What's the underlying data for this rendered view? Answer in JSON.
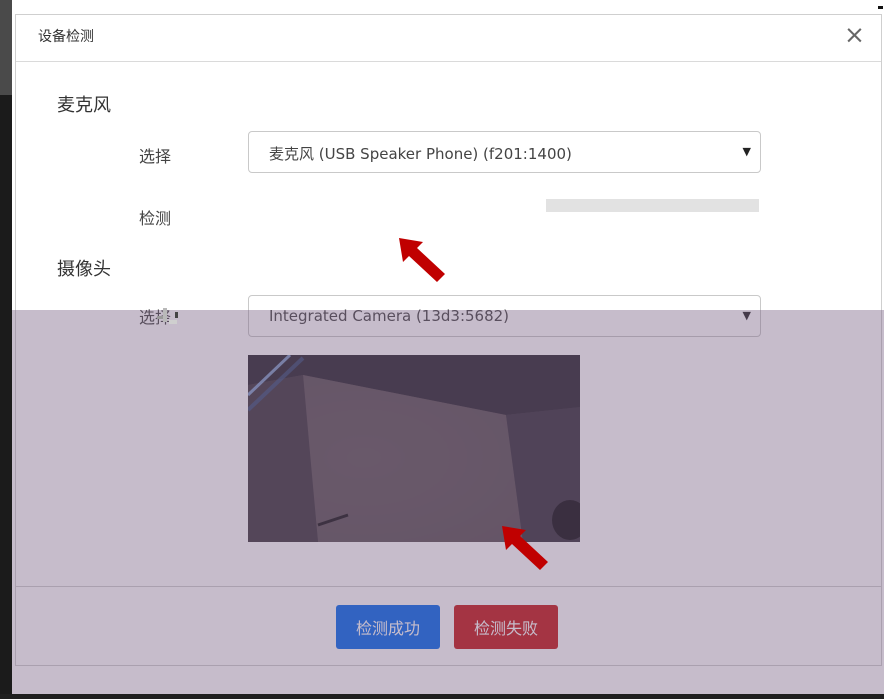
{
  "dialog": {
    "title": "设备检测",
    "close_glyph": "×"
  },
  "microphone": {
    "section_label": "麦克风",
    "select_label": "选择",
    "selected_device": "麦克风 (USB Speaker Phone) (f201:1400)",
    "test_label": "检测",
    "input_level": 0
  },
  "camera": {
    "section_label": "摄像头",
    "select_label": "选择",
    "selected_device": "Integrated Camera (13d3:5682)"
  },
  "footer": {
    "success_button": "检测成功",
    "fail_button": "检测失败"
  },
  "icons": {
    "close": "close-icon",
    "dropdown": "caret-down-icon",
    "annotation": "red-arrow-icon"
  },
  "colors": {
    "primary_button": "#0066ee",
    "danger_button": "#c41616",
    "annotation_arrow": "#c00000",
    "overlay_tint": "#786082"
  }
}
